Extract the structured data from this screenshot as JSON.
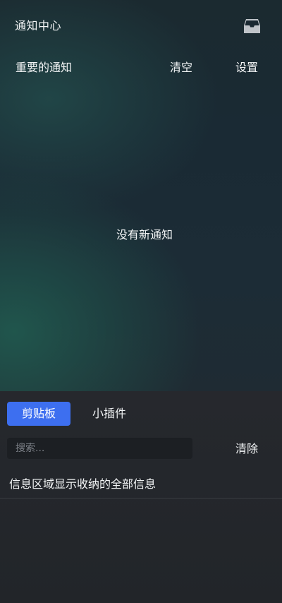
{
  "header": {
    "title": "通知中心",
    "inbox_icon": "inbox-tray-icon"
  },
  "notifications": {
    "important_label": "重要的通知",
    "clear_all_label": "清空",
    "settings_label": "设置",
    "empty_message": "没有新通知"
  },
  "clipboard_panel": {
    "tabs": [
      {
        "label": "剪贴板",
        "active": true
      },
      {
        "label": "小插件",
        "active": false
      }
    ],
    "search": {
      "placeholder": "搜索...",
      "value": ""
    },
    "clear_label": "清除",
    "info_text": "信息区域显示收纳的全部信息"
  },
  "colors": {
    "accent": "#3d6ff0",
    "text": "#f2f4f5",
    "panel_bg": "#24272c"
  }
}
